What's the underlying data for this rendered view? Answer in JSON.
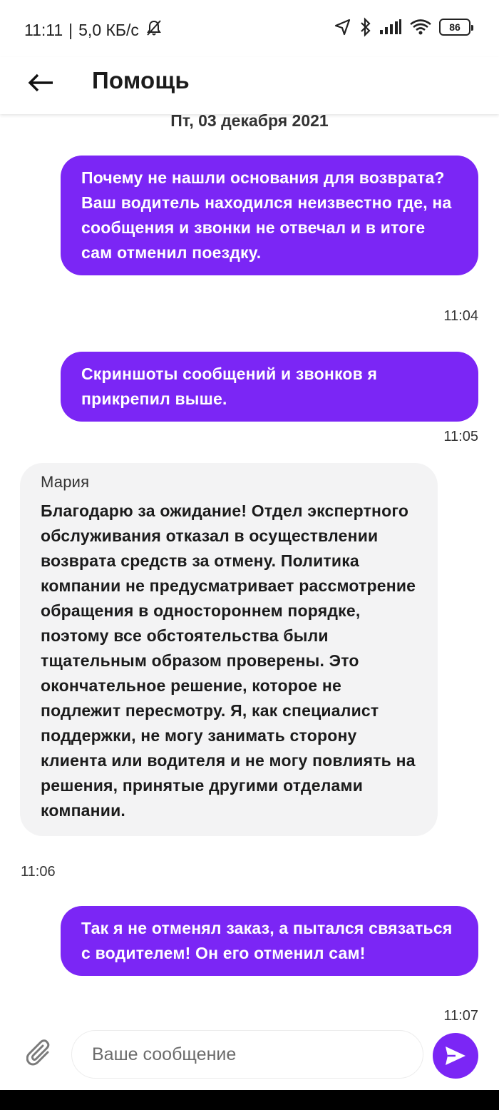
{
  "status_bar": {
    "time": "11:11",
    "speed": "5,0 КБ/с",
    "battery": "86",
    "icons": [
      "mute-icon",
      "location-icon",
      "bluetooth-icon",
      "signal-icon",
      "wifi-icon",
      "battery-icon"
    ]
  },
  "header": {
    "back_icon": "arrow-left-icon",
    "title": "Помощь"
  },
  "chat": {
    "date": "Пт, 03 декабря 2021",
    "messages": [
      {
        "direction": "out",
        "text": "Почему не нашли основания для возврата? Ваш водитель находился неизвестно где, на сообщения и звонки не отвечал и в итоге сам отменил поездку.",
        "time": "11:04"
      },
      {
        "direction": "out",
        "text": "Скриншоты сообщений и звонков я прикрепил выше.",
        "time": "11:05"
      },
      {
        "direction": "in",
        "sender": "Мария",
        "text": "Благодарю за ожидание!  Отдел экспертного обслуживания отказал в осуществлении возврата средств за отмену. Политика компании не предусматривает рассмотрение обращения в одностороннем порядке, поэтому все обстоятельства были тщательным образом проверены. Это окончательное решение, которое не подлежит пересмотру. Я, как специалист поддержки, не могу занимать сторону клиента или водителя и не могу повлиять на решения, принятые другими отделами компании.",
        "time": "11:06"
      },
      {
        "direction": "out",
        "text": "Так я не отменял заказ, а пытался связаться с водителем! Он его отменил сам!",
        "time": "11:07"
      }
    ]
  },
  "input": {
    "placeholder": "Ваше сообщение",
    "value": "",
    "attach_icon": "paperclip-icon",
    "send_icon": "send-icon"
  },
  "colors": {
    "accent": "#7b26f5",
    "incoming_bubble": "#f3f3f4"
  }
}
